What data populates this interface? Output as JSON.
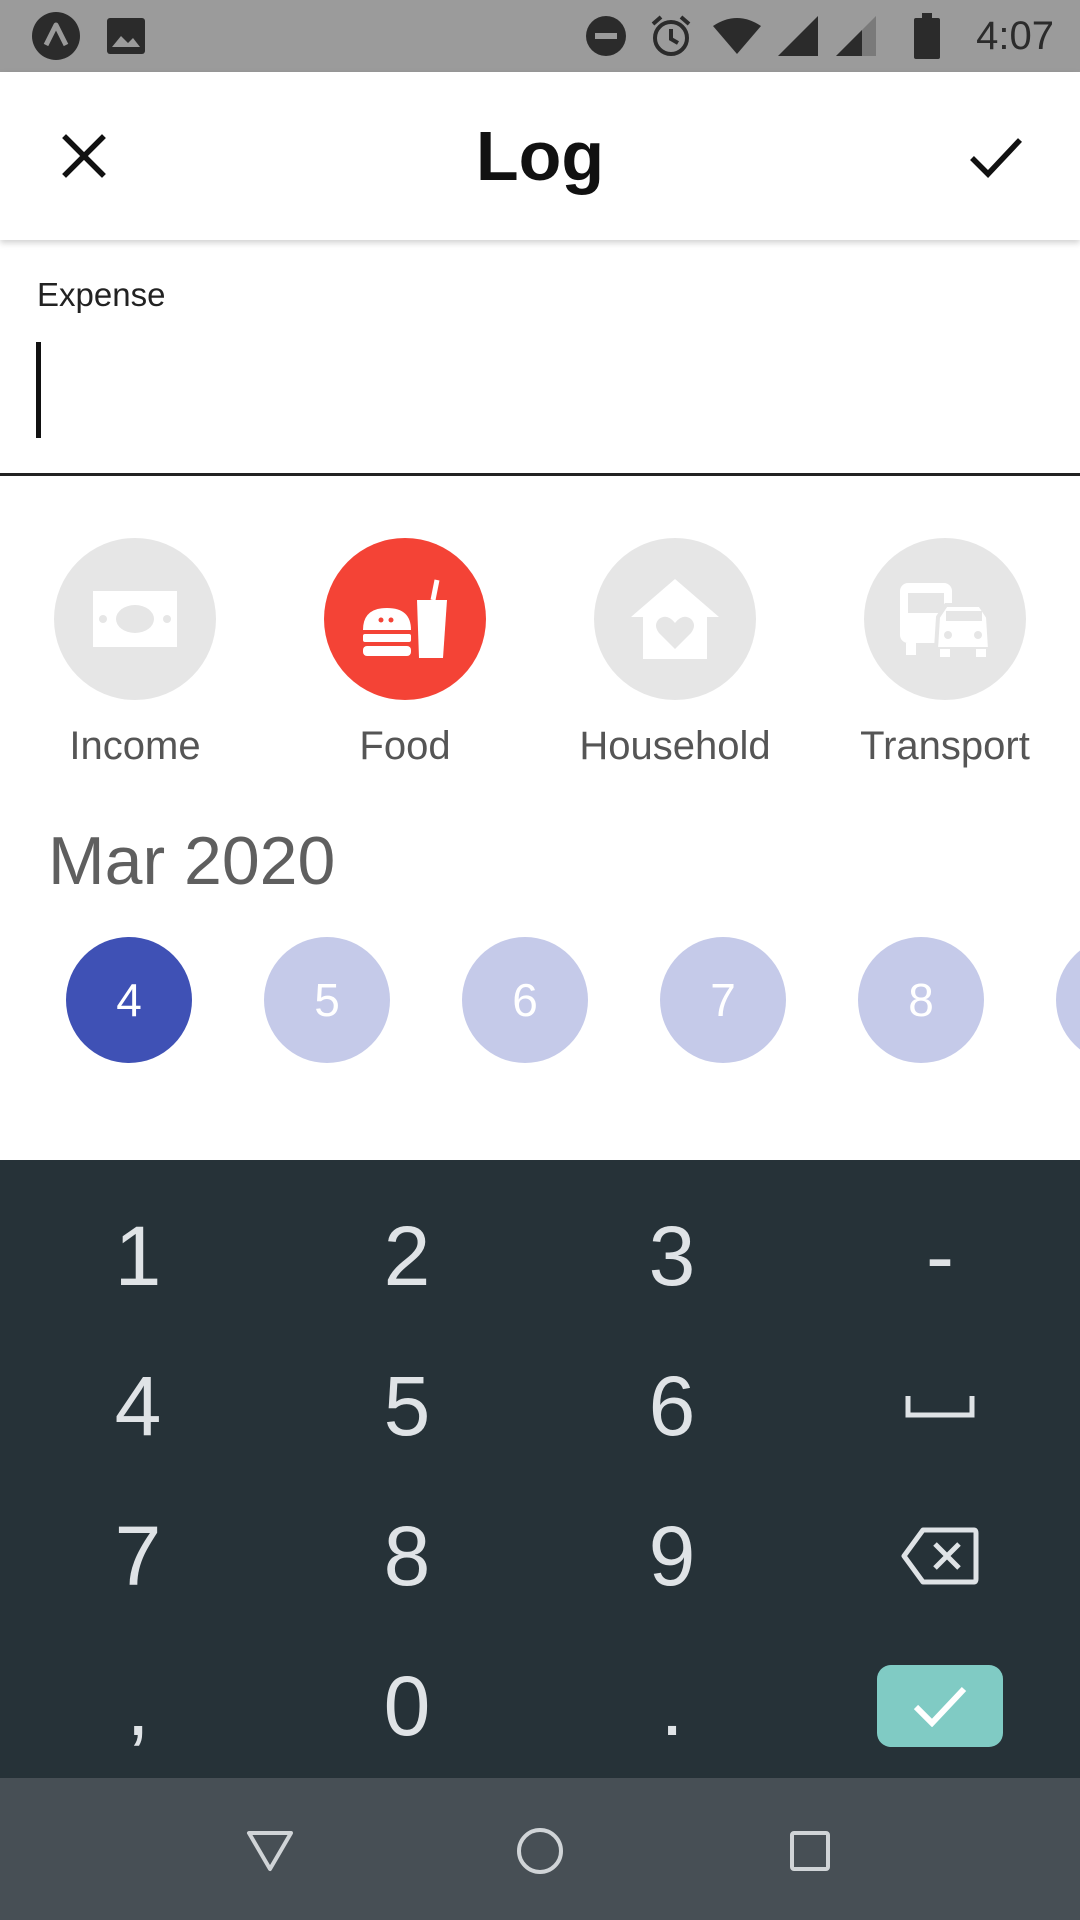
{
  "status_bar": {
    "time": "4:07",
    "left_icons": [
      "app-notification-icon",
      "image-notification-icon"
    ],
    "right_icons": [
      "do-not-disturb-icon",
      "alarm-icon",
      "wifi-icon",
      "cell-signal-icon",
      "cell-signal-2-icon",
      "battery-icon"
    ]
  },
  "app_bar": {
    "title": "Log",
    "close_icon": "close-icon",
    "confirm_icon": "check-icon"
  },
  "expense": {
    "label": "Expense",
    "value": ""
  },
  "categories": [
    {
      "label": "Income",
      "icon": "money-icon",
      "selected": false
    },
    {
      "label": "Food",
      "icon": "food-icon",
      "selected": true
    },
    {
      "label": "Household",
      "icon": "household-icon",
      "selected": false
    },
    {
      "label": "Transport",
      "icon": "transport-icon",
      "selected": false
    }
  ],
  "colors": {
    "category_selected": "#f44336",
    "category_default": "#e6e6e6",
    "date_selected": "#3f51b5",
    "date_default": "#c5cae9",
    "keypad_bg": "#263238",
    "done_key": "#80cbc4"
  },
  "dates": {
    "month": "Mar 2020",
    "days": [
      "4",
      "5",
      "6",
      "7",
      "8"
    ],
    "selected": "4"
  },
  "keypad": {
    "rows": [
      [
        "1",
        "2",
        "3",
        "-"
      ],
      [
        "4",
        "5",
        "6",
        "space-icon"
      ],
      [
        "7",
        "8",
        "9",
        "backspace-icon"
      ],
      [
        ",",
        "0",
        ".",
        "done-icon"
      ]
    ],
    "k1": "1",
    "k2": "2",
    "k3": "3",
    "minus": "-",
    "k4": "4",
    "k5": "5",
    "k6": "6",
    "k7": "7",
    "k8": "8",
    "k9": "9",
    "comma": ",",
    "k0": "0",
    "dot": "."
  },
  "nav_bar": {
    "icons": [
      "back-icon",
      "home-icon",
      "recents-icon"
    ]
  }
}
